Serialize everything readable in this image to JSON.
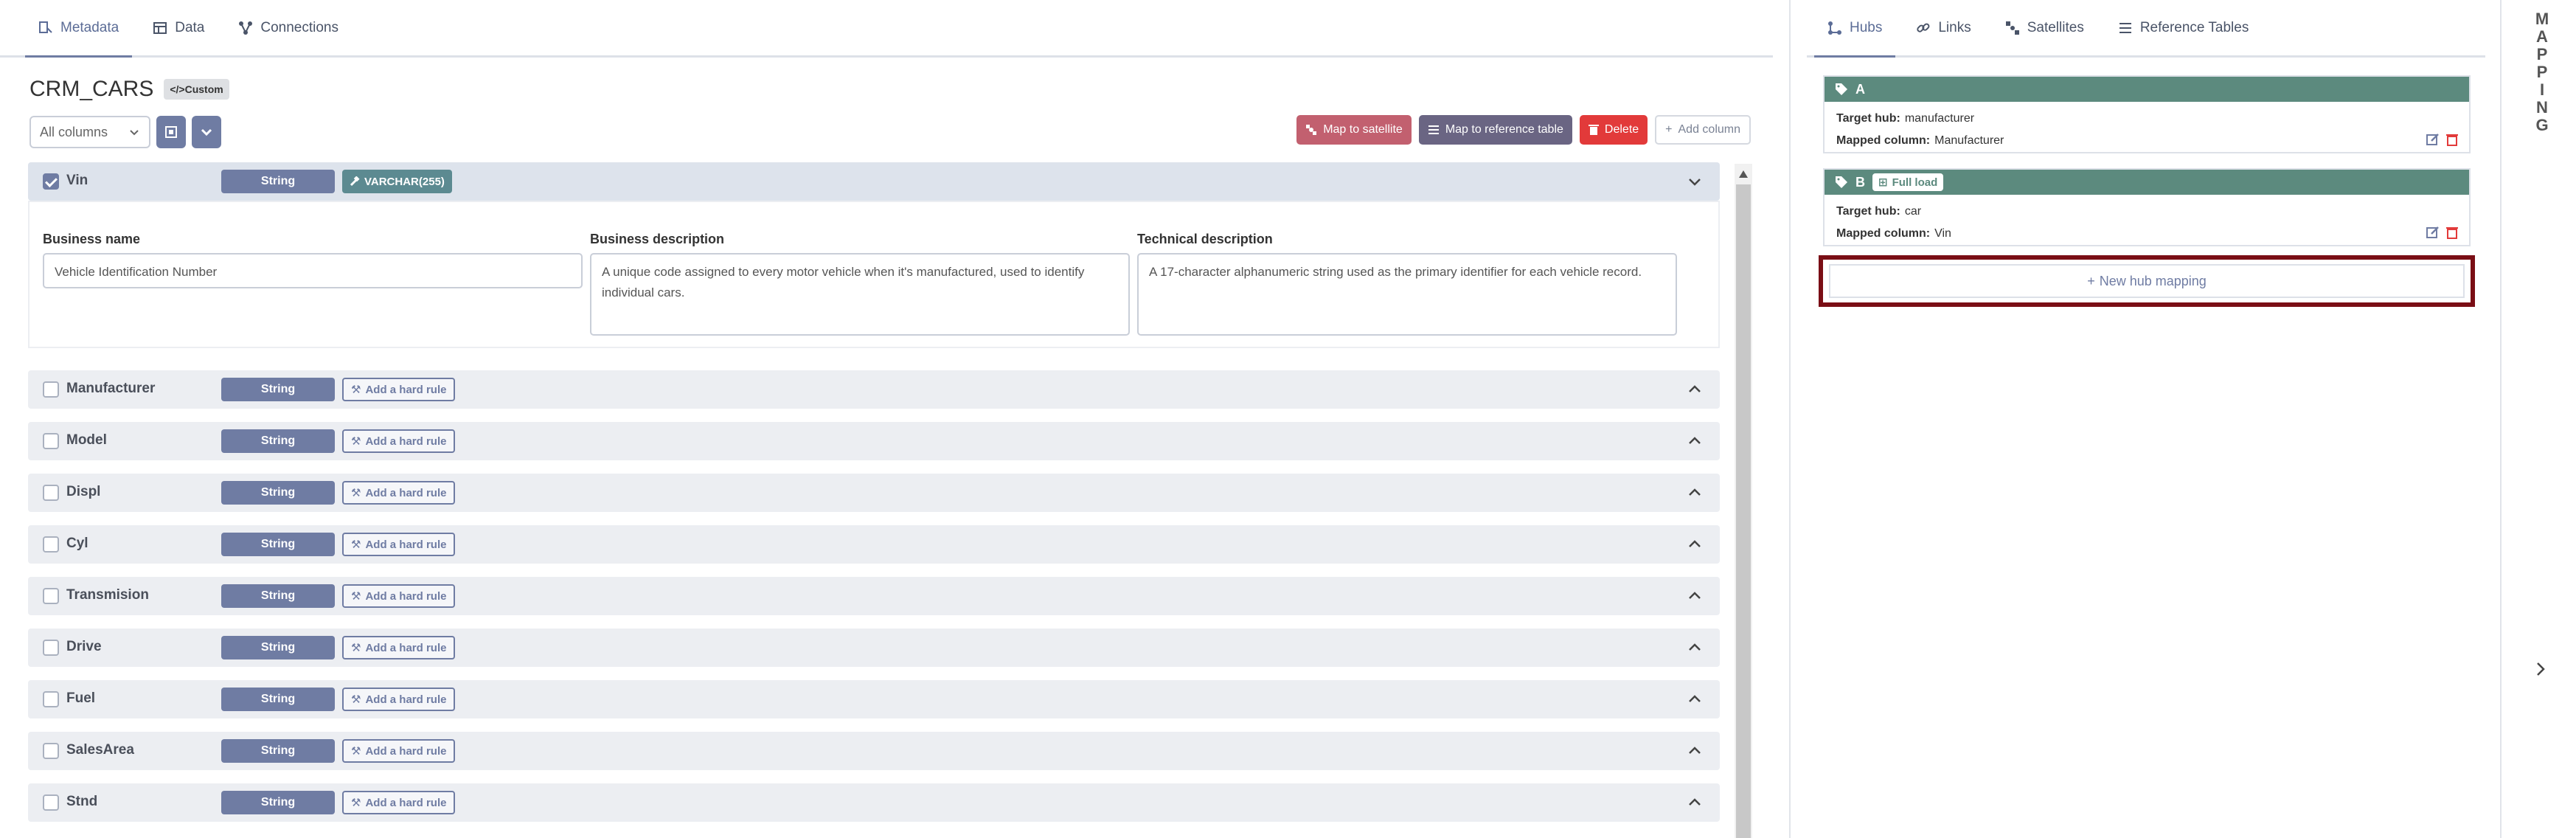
{
  "tabs": [
    {
      "label": "Metadata",
      "icon": "metadata-icon",
      "active": true
    },
    {
      "label": "Data",
      "icon": "table-icon",
      "active": false
    },
    {
      "label": "Connections",
      "icon": "connections-icon",
      "active": false
    }
  ],
  "entity": {
    "name": "CRM_CARS",
    "badge": "Custom"
  },
  "filter": {
    "selected": "All columns"
  },
  "actions": {
    "map_satellite": "Map to satellite",
    "map_reference": "Map to reference table",
    "delete": "Delete",
    "add_column": "Add column"
  },
  "expanded_column": {
    "name": "Vin",
    "type": "String",
    "datatype": "VARCHAR(255)",
    "business_name_label": "Business name",
    "business_name": "Vehicle Identification Number",
    "business_description_label": "Business description",
    "business_description": "A unique code assigned to every motor vehicle when it's manufactured, used to identify individual cars.",
    "technical_description_label": "Technical description",
    "technical_description": "A 17-character alphanumeric string used as the primary identifier for each vehicle record."
  },
  "columns": [
    {
      "name": "Manufacturer",
      "type": "String",
      "rule": "Add a hard rule"
    },
    {
      "name": "Model",
      "type": "String",
      "rule": "Add a hard rule"
    },
    {
      "name": "Displ",
      "type": "String",
      "rule": "Add a hard rule"
    },
    {
      "name": "Cyl",
      "type": "String",
      "rule": "Add a hard rule"
    },
    {
      "name": "Transmision",
      "type": "String",
      "rule": "Add a hard rule"
    },
    {
      "name": "Drive",
      "type": "String",
      "rule": "Add a hard rule"
    },
    {
      "name": "Fuel",
      "type": "String",
      "rule": "Add a hard rule"
    },
    {
      "name": "SalesArea",
      "type": "String",
      "rule": "Add a hard rule"
    },
    {
      "name": "Stnd",
      "type": "String",
      "rule": "Add a hard rule"
    }
  ],
  "right_tabs": [
    {
      "label": "Hubs",
      "icon": "hubs-icon",
      "active": true
    },
    {
      "label": "Links",
      "icon": "link-icon",
      "active": false
    },
    {
      "label": "Satellites",
      "icon": "satellite-icon",
      "active": false
    },
    {
      "label": "Reference Tables",
      "icon": "list-icon",
      "active": false
    }
  ],
  "hub_mappings": [
    {
      "id": "A",
      "target_label": "Target hub:",
      "target": "manufacturer",
      "mapped_label": "Mapped column:",
      "mapped": "Manufacturer",
      "badge": ""
    },
    {
      "id": "B",
      "target_label": "Target hub:",
      "target": "car",
      "mapped_label": "Mapped column:",
      "mapped": "Vin",
      "badge": "Full load"
    }
  ],
  "new_hub_mapping": "New hub mapping",
  "side_label": "MAPPING",
  "colors": {
    "accent": "#6f7ca3",
    "hub_header": "#5c8a7e",
    "satellite_btn": "#c2606f",
    "reference_btn": "#6a6583",
    "delete_btn": "#e23a3a",
    "highlight": "#7a0e15"
  }
}
